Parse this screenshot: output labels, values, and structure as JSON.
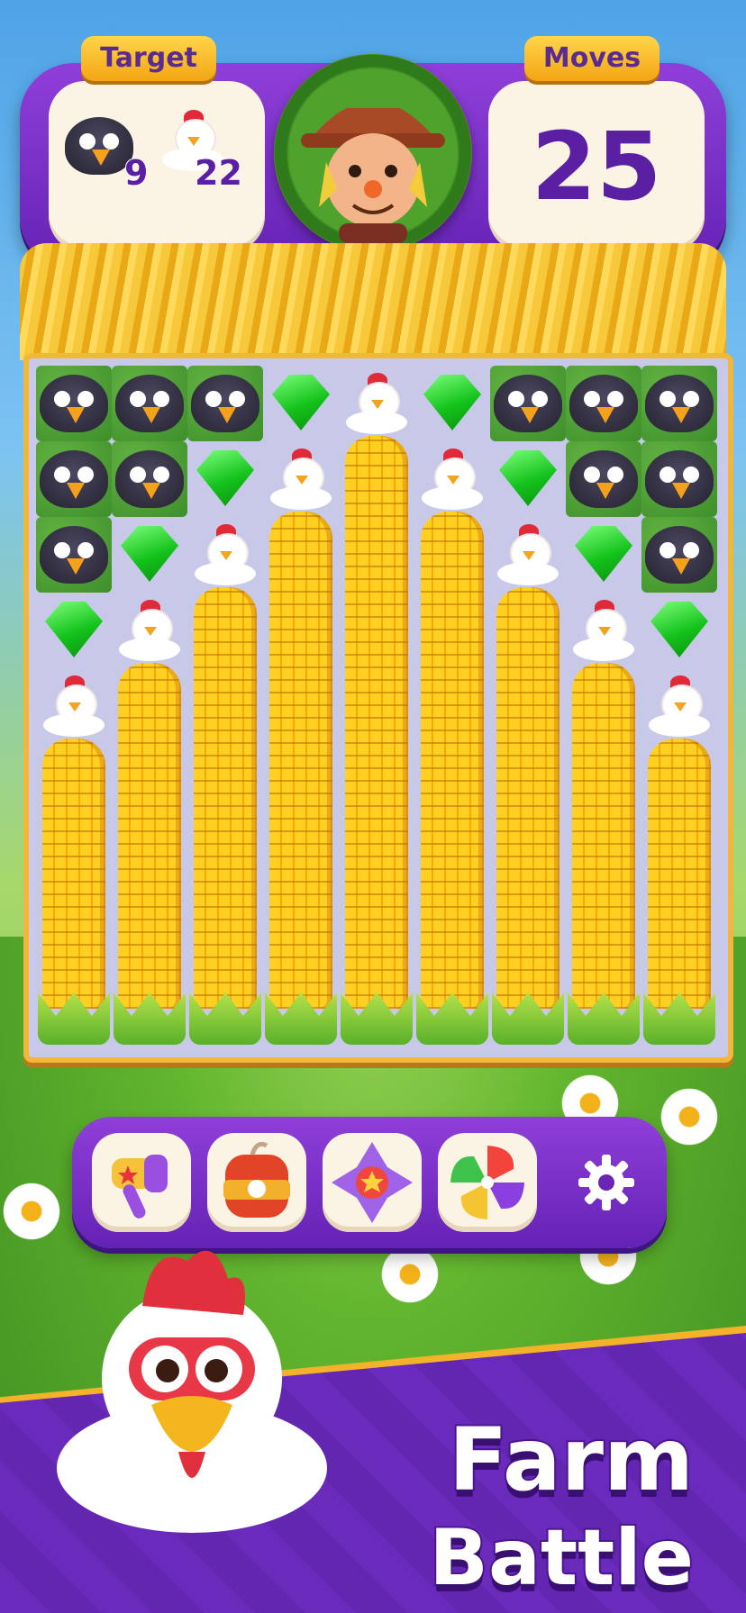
{
  "header": {
    "target_label": "Target",
    "moves_label": "Moves",
    "moves_count": "25",
    "targets": [
      {
        "icon": "crow-icon",
        "count": "9"
      },
      {
        "icon": "chicken-icon",
        "count": "22"
      }
    ]
  },
  "board": {
    "columns": 9,
    "rows": 9
  },
  "boosters": [
    {
      "icon": "hammer-icon"
    },
    {
      "icon": "bomb-icon"
    },
    {
      "icon": "cross-rocket-icon"
    },
    {
      "icon": "pinwheel-icon"
    },
    {
      "icon": "gear-icon"
    }
  ],
  "banner": {
    "title_line1": "Farm",
    "title_line2": "Battle"
  },
  "colors": {
    "panel_purple": "#6c2bbf",
    "gold": "#f3a514",
    "gem_green": "#14c21b",
    "text_purple": "#5a1fa3"
  }
}
